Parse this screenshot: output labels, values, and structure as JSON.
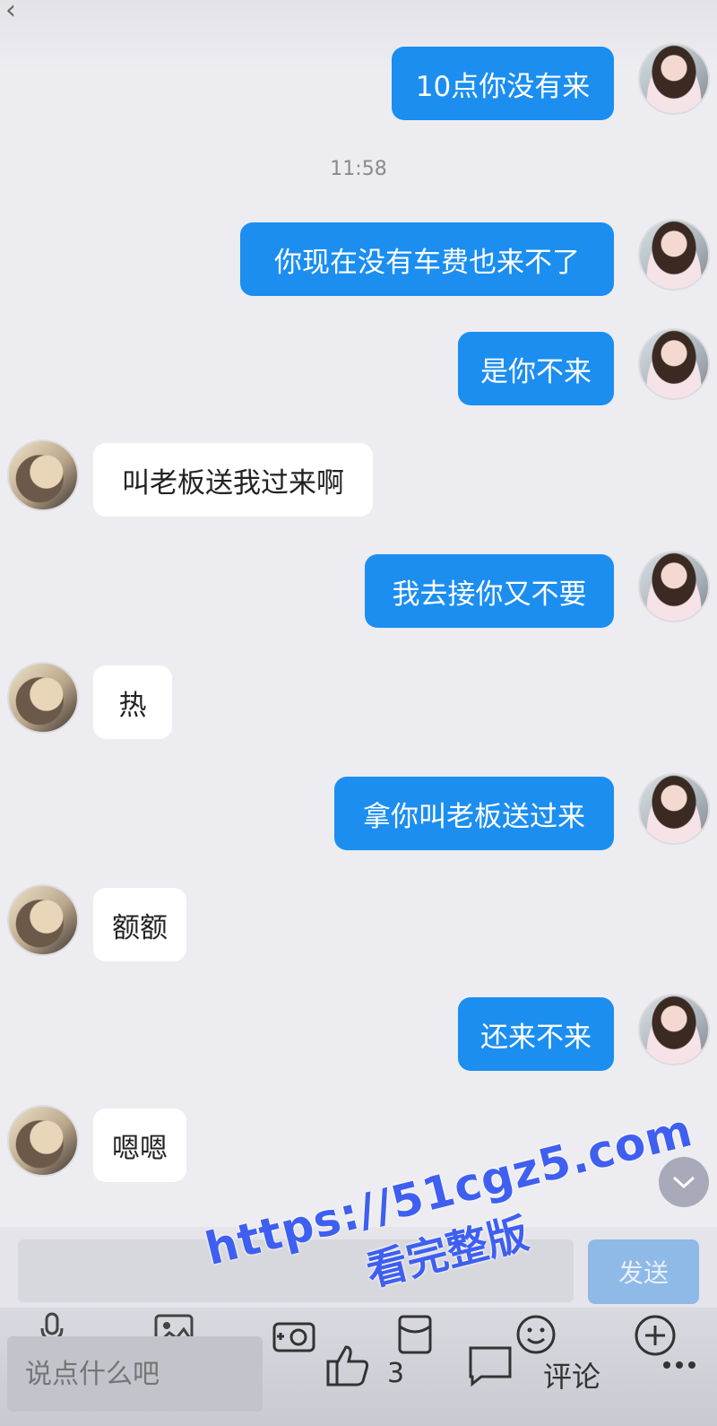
{
  "timestamp": "11:58",
  "messages": [
    {
      "from": "me",
      "text": "10点你没有来"
    },
    {
      "from": "me",
      "text": "你现在没有车费也来不了"
    },
    {
      "from": "me",
      "text": "是你不来"
    },
    {
      "from": "other",
      "text": "叫老板送我过来啊"
    },
    {
      "from": "me",
      "text": "我去接你又不要"
    },
    {
      "from": "other",
      "text": "热"
    },
    {
      "from": "me",
      "text": "拿你叫老板送过来"
    },
    {
      "from": "other",
      "text": "额额"
    },
    {
      "from": "me",
      "text": "还来不来"
    },
    {
      "from": "other",
      "text": "嗯嗯"
    }
  ],
  "composer": {
    "input_value": "",
    "send_label": "发送"
  },
  "bottom": {
    "comment_placeholder": "说点什么吧",
    "like_count": "3",
    "comment_label": "评论"
  },
  "watermark": {
    "url": "https://51cgz5.com",
    "tag": "看完整版"
  },
  "colors": {
    "my_bubble": "#1b8ef0",
    "their_bubble": "#ffffff",
    "background": "#ececf1",
    "send_button": "#8fb9e6"
  }
}
